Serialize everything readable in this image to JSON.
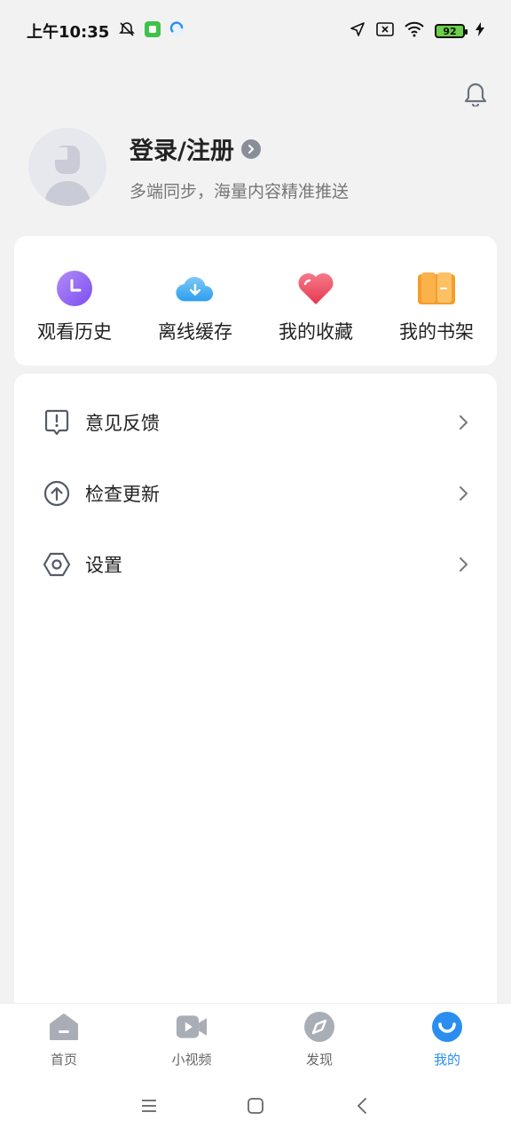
{
  "status_bar": {
    "time": "上午10:35",
    "battery": "92"
  },
  "profile": {
    "title": "登录/注册",
    "subtitle": "多端同步，海量内容精准推送"
  },
  "quick_actions": [
    {
      "label": "观看历史",
      "icon": "clock-icon",
      "color": "#8b5cf6"
    },
    {
      "label": "离线缓存",
      "icon": "cloud-download-icon",
      "color": "#3aa8ee"
    },
    {
      "label": "我的收藏",
      "icon": "heart-icon",
      "color": "#ef5466"
    },
    {
      "label": "我的书架",
      "icon": "book-icon",
      "color": "#f7a53a"
    }
  ],
  "menu": [
    {
      "label": "意见反馈",
      "icon": "feedback-icon"
    },
    {
      "label": "检查更新",
      "icon": "update-icon"
    },
    {
      "label": "设置",
      "icon": "settings-icon"
    }
  ],
  "tabs": [
    {
      "label": "首页",
      "icon": "home-icon",
      "active": false
    },
    {
      "label": "小视频",
      "icon": "video-icon",
      "active": false
    },
    {
      "label": "发现",
      "icon": "compass-icon",
      "active": false
    },
    {
      "label": "我的",
      "icon": "profile-icon",
      "active": true
    }
  ],
  "colors": {
    "accent": "#2a8ef0",
    "background": "#f2f2f2"
  }
}
